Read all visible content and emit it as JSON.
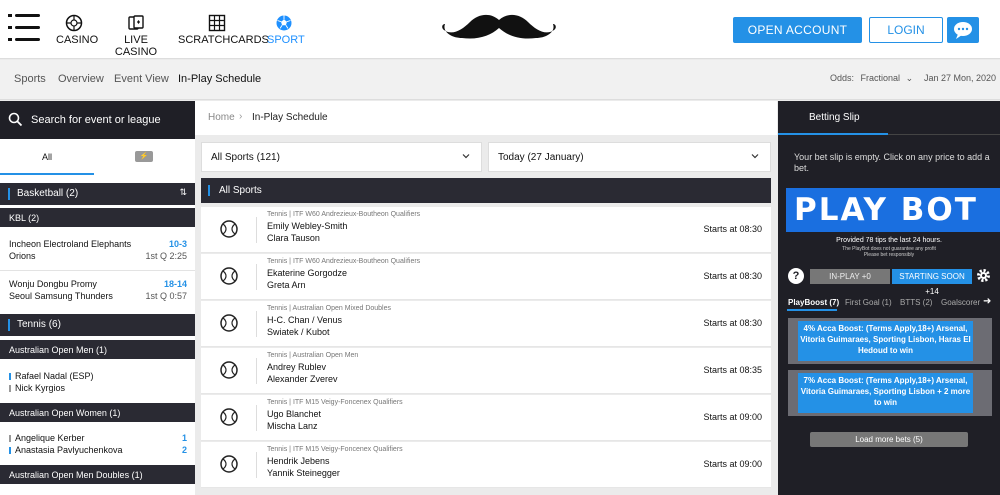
{
  "header": {
    "nav": [
      {
        "label": "CASINO",
        "icon": "roulette-icon"
      },
      {
        "label": "LIVE CASINO",
        "icon": "cards-icon"
      },
      {
        "label": "SCRATCHCARDS",
        "icon": "grid-icon"
      },
      {
        "label": "SPORT",
        "icon": "soccer-ball-icon",
        "active": true
      }
    ],
    "open_account": "OPEN ACCOUNT",
    "login": "LOGIN",
    "accent": "#2491e6"
  },
  "subnav": {
    "links": [
      "Sports",
      "Overview",
      "Event View",
      "In-Play Schedule"
    ],
    "odds_label": "Odds:",
    "odds_value": "Fractional",
    "date": "Jan 27 Mon, 2020"
  },
  "left": {
    "search_placeholder": "Search for event or league",
    "tab_all": "All",
    "basketball": {
      "title": "Basketball",
      "count": "(2)"
    },
    "kbl": "KBL (2)",
    "matches_bb": [
      {
        "t1": "Incheon Electroland Elephants",
        "t2": "Orions",
        "score": "10-3",
        "status": "1st Q 2:25"
      },
      {
        "t1": "Wonju Dongbu Promy",
        "t2": "Seoul Samsung Thunders",
        "score": "18-14",
        "status": "1st Q 0:57"
      }
    ],
    "tennis": {
      "title": "Tennis",
      "count": "(6)"
    },
    "ao_men": "Australian Open Men (1)",
    "ao_men_match": {
      "t1": "Rafael Nadal (ESP)",
      "t2": "Nick Kyrgios"
    },
    "ao_women": "Australian Open Women (1)",
    "ao_women_match": {
      "t1": "Angelique Kerber",
      "t2": "Anastasia Pavlyuchenkova",
      "s1": "1",
      "s2": "2"
    },
    "ao_men_doubles": "Australian Open Men Doubles (1)"
  },
  "main": {
    "breadcrumb": {
      "home": "Home",
      "current": "In-Play Schedule"
    },
    "sports_dropdown": "All Sports (121)",
    "date_dropdown": "Today (27 January)",
    "section_title": "All Sports",
    "events": [
      {
        "comp": "Tennis | ITF W60 Andrezieux-Boutheon Qualifiers",
        "p1": "Emily Webley-Smith",
        "p2": "Clara Tauson",
        "starts": "Starts at 08:30"
      },
      {
        "comp": "Tennis | ITF W60 Andrezieux-Boutheon Qualifiers",
        "p1": "Ekaterine Gorgodze",
        "p2": "Greta Arn",
        "starts": "Starts at 08:30"
      },
      {
        "comp": "Tennis | Australian Open Mixed Doubles",
        "p1": "H-C. Chan / Venus",
        "p2": "Swiatek / Kubot",
        "starts": "Starts at 08:30"
      },
      {
        "comp": "Tennis | Australian Open Men",
        "p1": "Andrey Rublev",
        "p2": "Alexander Zverev",
        "starts": "Starts at 08:35"
      },
      {
        "comp": "Tennis | ITF M15 Veigy-Foncenex Qualifiers",
        "p1": "Ugo Blanchet",
        "p2": "Mischa Lanz",
        "starts": "Starts at 09:00"
      },
      {
        "comp": "Tennis | ITF M15 Veigy-Foncenex Qualifiers",
        "p1": "Hendrik Jebens",
        "p2": "Yannik Steinegger",
        "starts": "Starts at 09:00"
      }
    ]
  },
  "slip": {
    "title": "Betting Slip",
    "empty_msg": "Your bet slip is empty. Click on any price to add a bet.",
    "banner": "PLAY BOT",
    "provided": "Provided 78 tips the last 24 hours.",
    "disclaimer": "The PlayBot does not guarantee any profit",
    "responsibly": "Please bet responsibly",
    "help": "?",
    "inplay": "IN-PLAY +0",
    "soon": "STARTING SOON +14",
    "tabs": [
      "PlayBoost (7)",
      "First Goal (1)",
      "BTTS (2)",
      "Goalscorer ("
    ],
    "boosts": [
      "4% Acca Boost: (Terms Apply,18+) Arsenal, Vitoria Guimaraes, Sporting Lisbon, Haras El Hedoud to win",
      "7% Acca Boost: (Terms Apply,18+) Arsenal, Vitoria Guimaraes, Sporting Lisbon + 2 more to win"
    ],
    "load_more": "Load more bets (5)"
  }
}
